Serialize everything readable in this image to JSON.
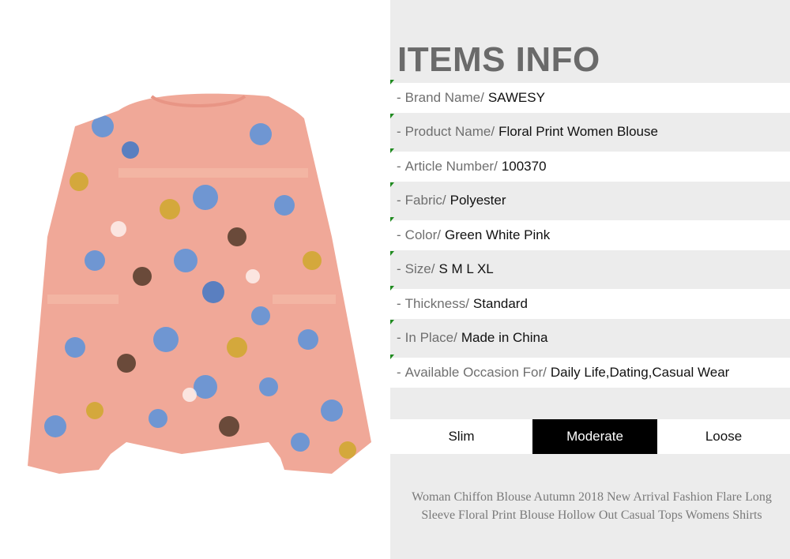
{
  "header": {
    "title": "ITEMS INFO"
  },
  "info": [
    {
      "label": "Brand Name/",
      "value": "SAWESY"
    },
    {
      "label": "Product Name/",
      "value": "Floral Print Women Blouse"
    },
    {
      "label": "Article Number/",
      "value": "100370"
    },
    {
      "label": "Fabric/",
      "value": "Polyester"
    },
    {
      "label": "Color/",
      "value": "Green White Pink"
    },
    {
      "label": "Size/",
      "value": "S M L XL"
    },
    {
      "label": "Thickness/",
      "value": "Standard"
    },
    {
      "label": "In Place/",
      "value": "Made in China"
    },
    {
      "label": "Available Occasion For/",
      "value": "Daily Life,Dating,Casual Wear"
    }
  ],
  "fit": {
    "options": [
      "Slim",
      "Moderate",
      "Loose"
    ],
    "selected": "Moderate"
  },
  "description": "Woman Chiffon Blouse Autumn 2018 New Arrival Fashion Flare Long Sleeve Floral Print Blouse Hollow Out Casual Tops Womens Shirts",
  "colors": {
    "blouse_pink": "#f0a898",
    "flower_blue": "#6f96d2",
    "flower_yellow": "#d4a83c",
    "flower_brown": "#6a4a3a",
    "lace": "#f3b5a3",
    "marker_green": "#1f8a1f"
  }
}
